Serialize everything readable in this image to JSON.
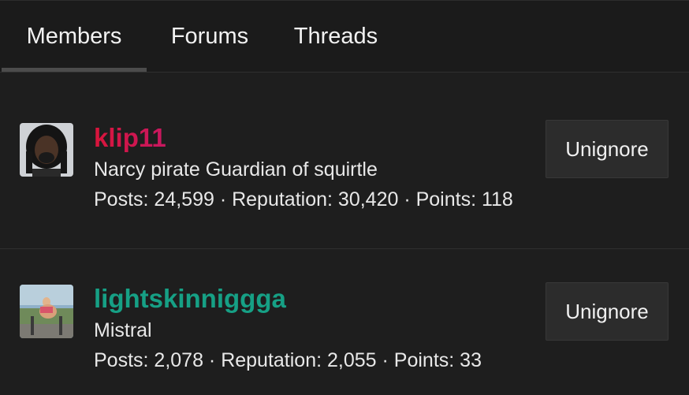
{
  "tabs": [
    {
      "label": "Members",
      "active": true
    },
    {
      "label": "Forums",
      "active": false
    },
    {
      "label": "Threads",
      "active": false
    }
  ],
  "members": [
    {
      "username": "klip11",
      "title": "Narcy pirate Guardian of squirtle",
      "stats": "Posts: 24,599 · Reputation: 30,420 · Points: 118",
      "button": "Unignore",
      "username_colors": [
        "#d8153b",
        "#7b24e6"
      ]
    },
    {
      "username": "lightskinniggga",
      "title": "Mistral",
      "stats": "Posts: 2,078 · Reputation: 2,055 · Points: 33",
      "button": "Unignore",
      "username_color": "#16a085"
    }
  ]
}
